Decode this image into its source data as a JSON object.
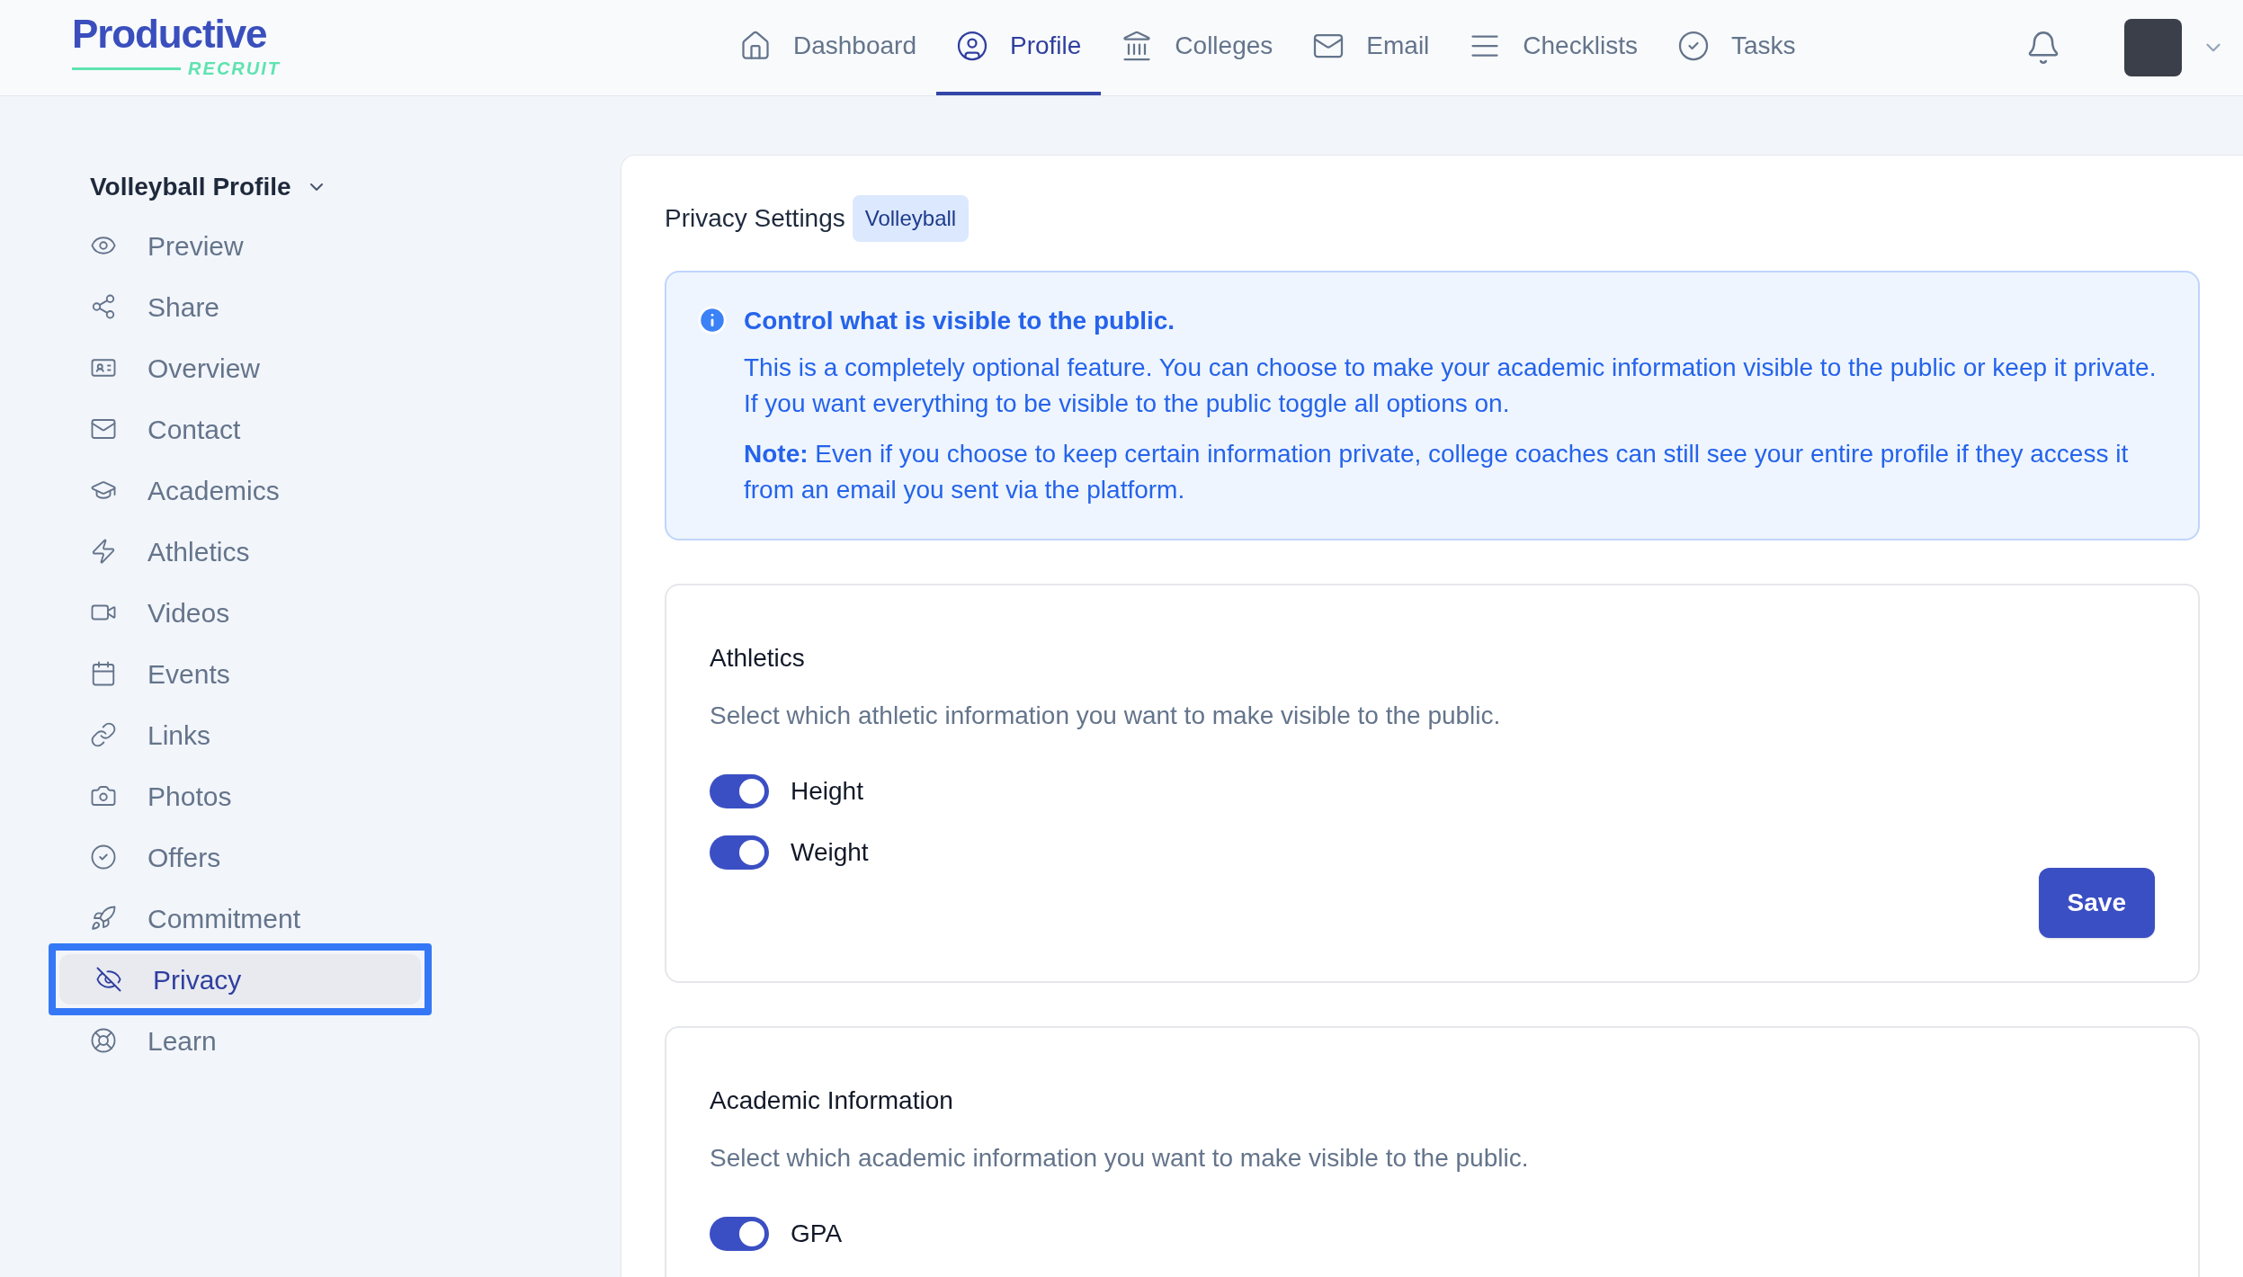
{
  "logo": {
    "name": "Productive",
    "tagline": "RECRUIT"
  },
  "nav": [
    {
      "label": "Dashboard",
      "kind": "home",
      "selected": false
    },
    {
      "label": "Profile",
      "kind": "user",
      "selected": true
    },
    {
      "label": "Colleges",
      "kind": "bank",
      "selected": false
    },
    {
      "label": "Email",
      "kind": "mail",
      "selected": false
    },
    {
      "label": "Checklists",
      "kind": "list",
      "selected": false
    },
    {
      "label": "Tasks",
      "kind": "check",
      "selected": false
    }
  ],
  "sidebar": {
    "title": "Volleyball Profile",
    "items": [
      {
        "label": "Preview",
        "kind": "eye",
        "selected": false
      },
      {
        "label": "Share",
        "kind": "share",
        "selected": false
      },
      {
        "label": "Overview",
        "kind": "card",
        "selected": false
      },
      {
        "label": "Contact",
        "kind": "mail",
        "selected": false
      },
      {
        "label": "Academics",
        "kind": "cap",
        "selected": false
      },
      {
        "label": "Athletics",
        "kind": "bolt",
        "selected": false
      },
      {
        "label": "Videos",
        "kind": "video",
        "selected": false
      },
      {
        "label": "Events",
        "kind": "calendar",
        "selected": false
      },
      {
        "label": "Links",
        "kind": "link",
        "selected": false
      },
      {
        "label": "Photos",
        "kind": "camera",
        "selected": false
      },
      {
        "label": "Offers",
        "kind": "check",
        "selected": false
      },
      {
        "label": "Commitment",
        "kind": "rocket",
        "selected": false
      },
      {
        "label": "Privacy",
        "kind": "eyeoff",
        "selected": true
      },
      {
        "label": "Learn",
        "kind": "lifebuoy",
        "selected": false
      }
    ]
  },
  "page": {
    "title": "Privacy Settings",
    "badge": "Volleyball"
  },
  "info": {
    "title": "Control what is visible to the public.",
    "paragraphs": [
      "This is a completely optional feature. You can choose to make your academic information visible to the public or keep it private. If you want everything to be visible to the public toggle all options on.",
      "**Note:** Even if you choose to keep certain information private, college coaches can still see your entire profile if they access it from an email you sent via the platform."
    ]
  },
  "sections": [
    {
      "title": "Athletics",
      "description": "Select which athletic information you want to make visible to the public.",
      "toggles": [
        {
          "label": "Height",
          "on": true
        },
        {
          "label": "Weight",
          "on": true
        }
      ],
      "button": "Save"
    },
    {
      "title": "Academic Information",
      "description": "Select which academic information you want to make visible to the public.",
      "toggles": [
        {
          "label": "GPA",
          "on": true
        }
      ]
    }
  ]
}
